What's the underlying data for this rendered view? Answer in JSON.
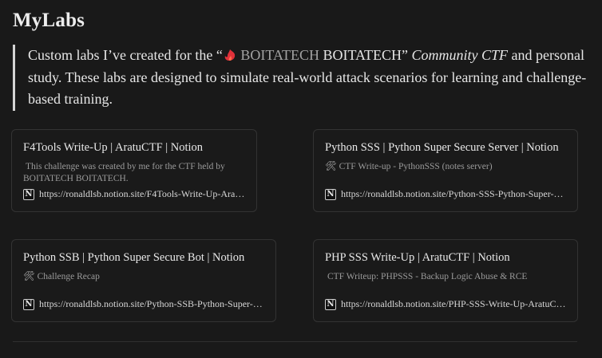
{
  "page": {
    "title": "MyLabs"
  },
  "intro": {
    "before": "Custom labs I’ve created for the “",
    "brand_muted": "BOITATECH",
    "brand": "BOITATECH",
    "quote_close": "”",
    "emphasis": "Community CTF",
    "after": " and personal study. These labs are designed to simulate real-world attack scenarios for learning and challenge-based training."
  },
  "cards": [
    {
      "title": "F4Tools Write-Up | AratuCTF | Notion",
      "tool_icon": "",
      "description": "This challenge was created by me for the CTF held by BOITATECH BOITATECH.",
      "url": "https://ronaldlsb.notion.site/F4Tools-Write-Up-AratuCTF"
    },
    {
      "title": "Python SSS | Python Super Secure Server | Notion",
      "tool_icon": "🛠",
      "description": "CTF Write-up - PythonSSS (notes server)",
      "url": "https://ronaldlsb.notion.site/Python-SSS-Python-Super-Secure-Server"
    },
    {
      "title": "Python SSB | Python Super Secure Bot | Notion",
      "tool_icon": "🛠",
      "description": "Challenge Recap",
      "url": "https://ronaldlsb.notion.site/Python-SSB-Python-Super-Secure-Bot"
    },
    {
      "title": "PHP SSS Write-Up | AratuCTF | Notion",
      "tool_icon": "",
      "description": "CTF Writeup: PHPSSS - Backup Logic Abuse & RCE",
      "url": "https://ronaldlsb.notion.site/PHP-SSS-Write-Up-AratuCTF"
    }
  ],
  "colors": {
    "background": "#191919",
    "accent_fire": "#e0313a",
    "card_border": "#333333"
  },
  "icons": {
    "brand": "fire-dragon-icon",
    "link": "notion-icon",
    "desc": "hammer-wrench-icon"
  }
}
